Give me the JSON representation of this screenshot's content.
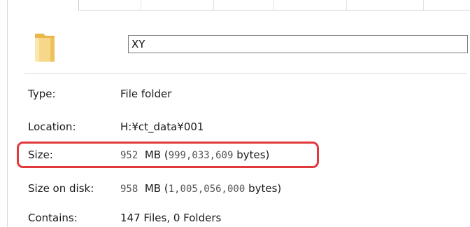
{
  "icons": {
    "folder": "folder-icon"
  },
  "name_field": {
    "value": "XY"
  },
  "properties": {
    "type": {
      "label": "Type:",
      "value": "File folder"
    },
    "location": {
      "label": "Location:",
      "value": "H:¥ct_data¥001"
    },
    "size": {
      "label": "Size:",
      "mb": "952",
      "mb_unit": "MB (",
      "bytes": "999,033,609",
      "bytes_unit": "bytes)"
    },
    "size_on_disk": {
      "label": "Size on disk:",
      "mb": "958",
      "mb_unit": "MB (",
      "bytes": "1,005,056,000",
      "bytes_unit": "bytes)"
    },
    "contains": {
      "label": "Contains:",
      "value": "147 Files, 0 Folders"
    }
  },
  "colors": {
    "highlight": "#e23a3a",
    "folder_light": "#f7d88a",
    "folder_dark": "#e8b84a"
  }
}
